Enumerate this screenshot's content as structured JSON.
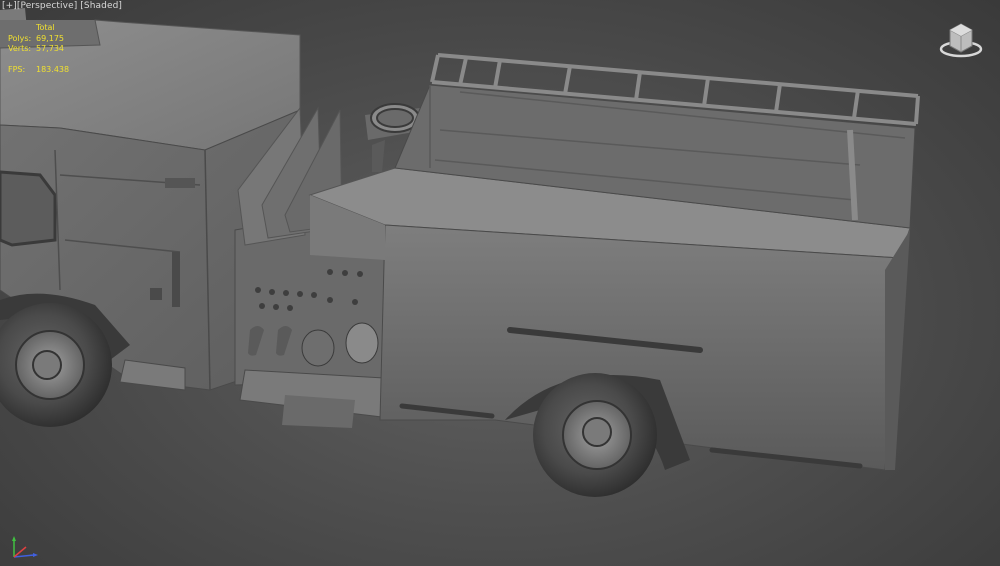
{
  "viewport": {
    "label_plus": "[+]",
    "label_view": "[Perspective]",
    "label_shading": "[Shaded]"
  },
  "stats": {
    "header": "Total",
    "polys_label": "Polys:",
    "polys_value": "69,175",
    "verts_label": "Verts:",
    "verts_value": "57,734",
    "fps_label": "FPS:",
    "fps_value": "183.438",
    "color": "#f0e030"
  },
  "viewcube": {
    "icon": "viewcube-icon"
  },
  "axis": {
    "icon": "axis-tripod-icon",
    "x_color": "#e04040",
    "y_color": "#40c040",
    "z_color": "#4060e0"
  },
  "colors": {
    "background": "#4f4f4f",
    "model": "#7a7a7a",
    "model_dark": "#4a4a4a"
  }
}
